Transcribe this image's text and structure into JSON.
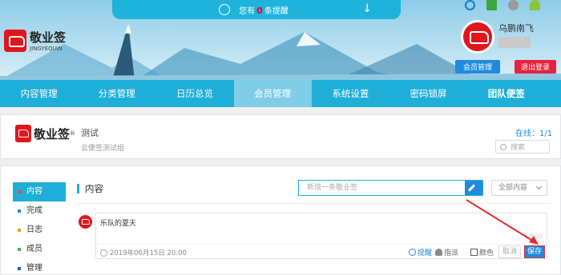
{
  "notice": {
    "prefix": "您有",
    "count": "0",
    "suffix": "条提醒"
  },
  "brand": {
    "cn": "敬业签",
    "en": "JINGYEQIAN",
    "reg": "®"
  },
  "platforms": [
    {
      "icon": "ie-icon",
      "color": "#1c7ccc"
    },
    {
      "icon": "windows-icon",
      "color": "#3ba63a"
    },
    {
      "icon": "apple-icon",
      "color": "#9a9a9a"
    },
    {
      "icon": "android-icon",
      "color": "#8cc43f"
    }
  ],
  "user": {
    "name": "乌鹏南飞",
    "member_btn": "会员管理",
    "logout_btn": "退出登录"
  },
  "nav": [
    "内容管理",
    "分类管理",
    "日历总览",
    "会员管理",
    "系统设置",
    "密码锁屏",
    "团队便签"
  ],
  "nav_active": 3,
  "team": {
    "name": "测试",
    "subtitle": "云便签测试组",
    "online": "在线：1/1",
    "search_placeholder": "搜索"
  },
  "sidebar": [
    {
      "label": "内容",
      "dot": "#e94b3c",
      "active": true
    },
    {
      "label": "完成",
      "dot": "#1f8ae0",
      "active": false
    },
    {
      "label": "日志",
      "dot": "#f0a020",
      "active": false
    },
    {
      "label": "成员",
      "dot": "#3cb54a",
      "active": false
    },
    {
      "label": "管理",
      "dot": "#2a5fb0",
      "active": false
    }
  ],
  "content": {
    "title": "内容",
    "new_placeholder": "新增一条敬业签",
    "filter": "全部内容"
  },
  "note": {
    "text": "乐队的夏天",
    "counter": "5/500",
    "date": "2019年06月15日 20:00",
    "remind": "提醒",
    "assign": "指派",
    "color": "颜色",
    "cancel": "取消",
    "save": "保存"
  },
  "colors": {
    "accent": "#1eaed8",
    "brand_red": "#e2151e",
    "primary_blue": "#1f8ae0"
  }
}
